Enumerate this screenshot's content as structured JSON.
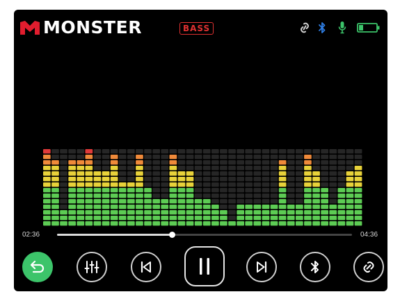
{
  "header": {
    "brand": "MONSTER",
    "badge": "BASS",
    "icons": [
      "link-icon",
      "bluetooth-icon",
      "microphone-icon",
      "battery-icon"
    ],
    "battery_level": 0.25,
    "colors": {
      "brand_red": "#e11d2e",
      "bluetooth": "#2f7fe6",
      "mic": "#3cc46a",
      "battery": "#3cc46a"
    }
  },
  "equalizer": {
    "max_level": 14,
    "levels": [
      14,
      12,
      3,
      12,
      12,
      14,
      10,
      10,
      13,
      8,
      8,
      13,
      7,
      5,
      5,
      13,
      10,
      10,
      5,
      5,
      4,
      3,
      1,
      4,
      4,
      4,
      4,
      4,
      12,
      4,
      4,
      13,
      10,
      7,
      4,
      7,
      10,
      11
    ],
    "peaks": [
      14,
      12,
      12,
      13,
      13,
      14,
      10,
      10,
      13,
      8,
      8,
      13,
      7,
      5,
      5,
      13,
      10,
      10,
      5,
      5,
      4,
      3,
      1,
      4,
      4,
      4,
      4,
      4,
      12,
      4,
      4,
      13,
      10,
      7,
      4,
      7,
      10,
      11
    ],
    "colors": {
      "green": "#5dcc54",
      "yellow": "#e8d23a",
      "orange": "#f08a3a",
      "red": "#e03a3a",
      "off": "#262626"
    }
  },
  "progress": {
    "elapsed": "02:36",
    "total": "04:36",
    "fraction": 0.39
  },
  "controls": [
    {
      "name": "back-button",
      "icon": "return-icon"
    },
    {
      "name": "equalizer-button",
      "icon": "equalizer-icon"
    },
    {
      "name": "previous-button",
      "icon": "previous-icon"
    },
    {
      "name": "pause-button",
      "icon": "pause-icon"
    },
    {
      "name": "next-button",
      "icon": "next-icon"
    },
    {
      "name": "bluetooth-button",
      "icon": "bluetooth-icon"
    },
    {
      "name": "link-button",
      "icon": "link-icon"
    }
  ]
}
